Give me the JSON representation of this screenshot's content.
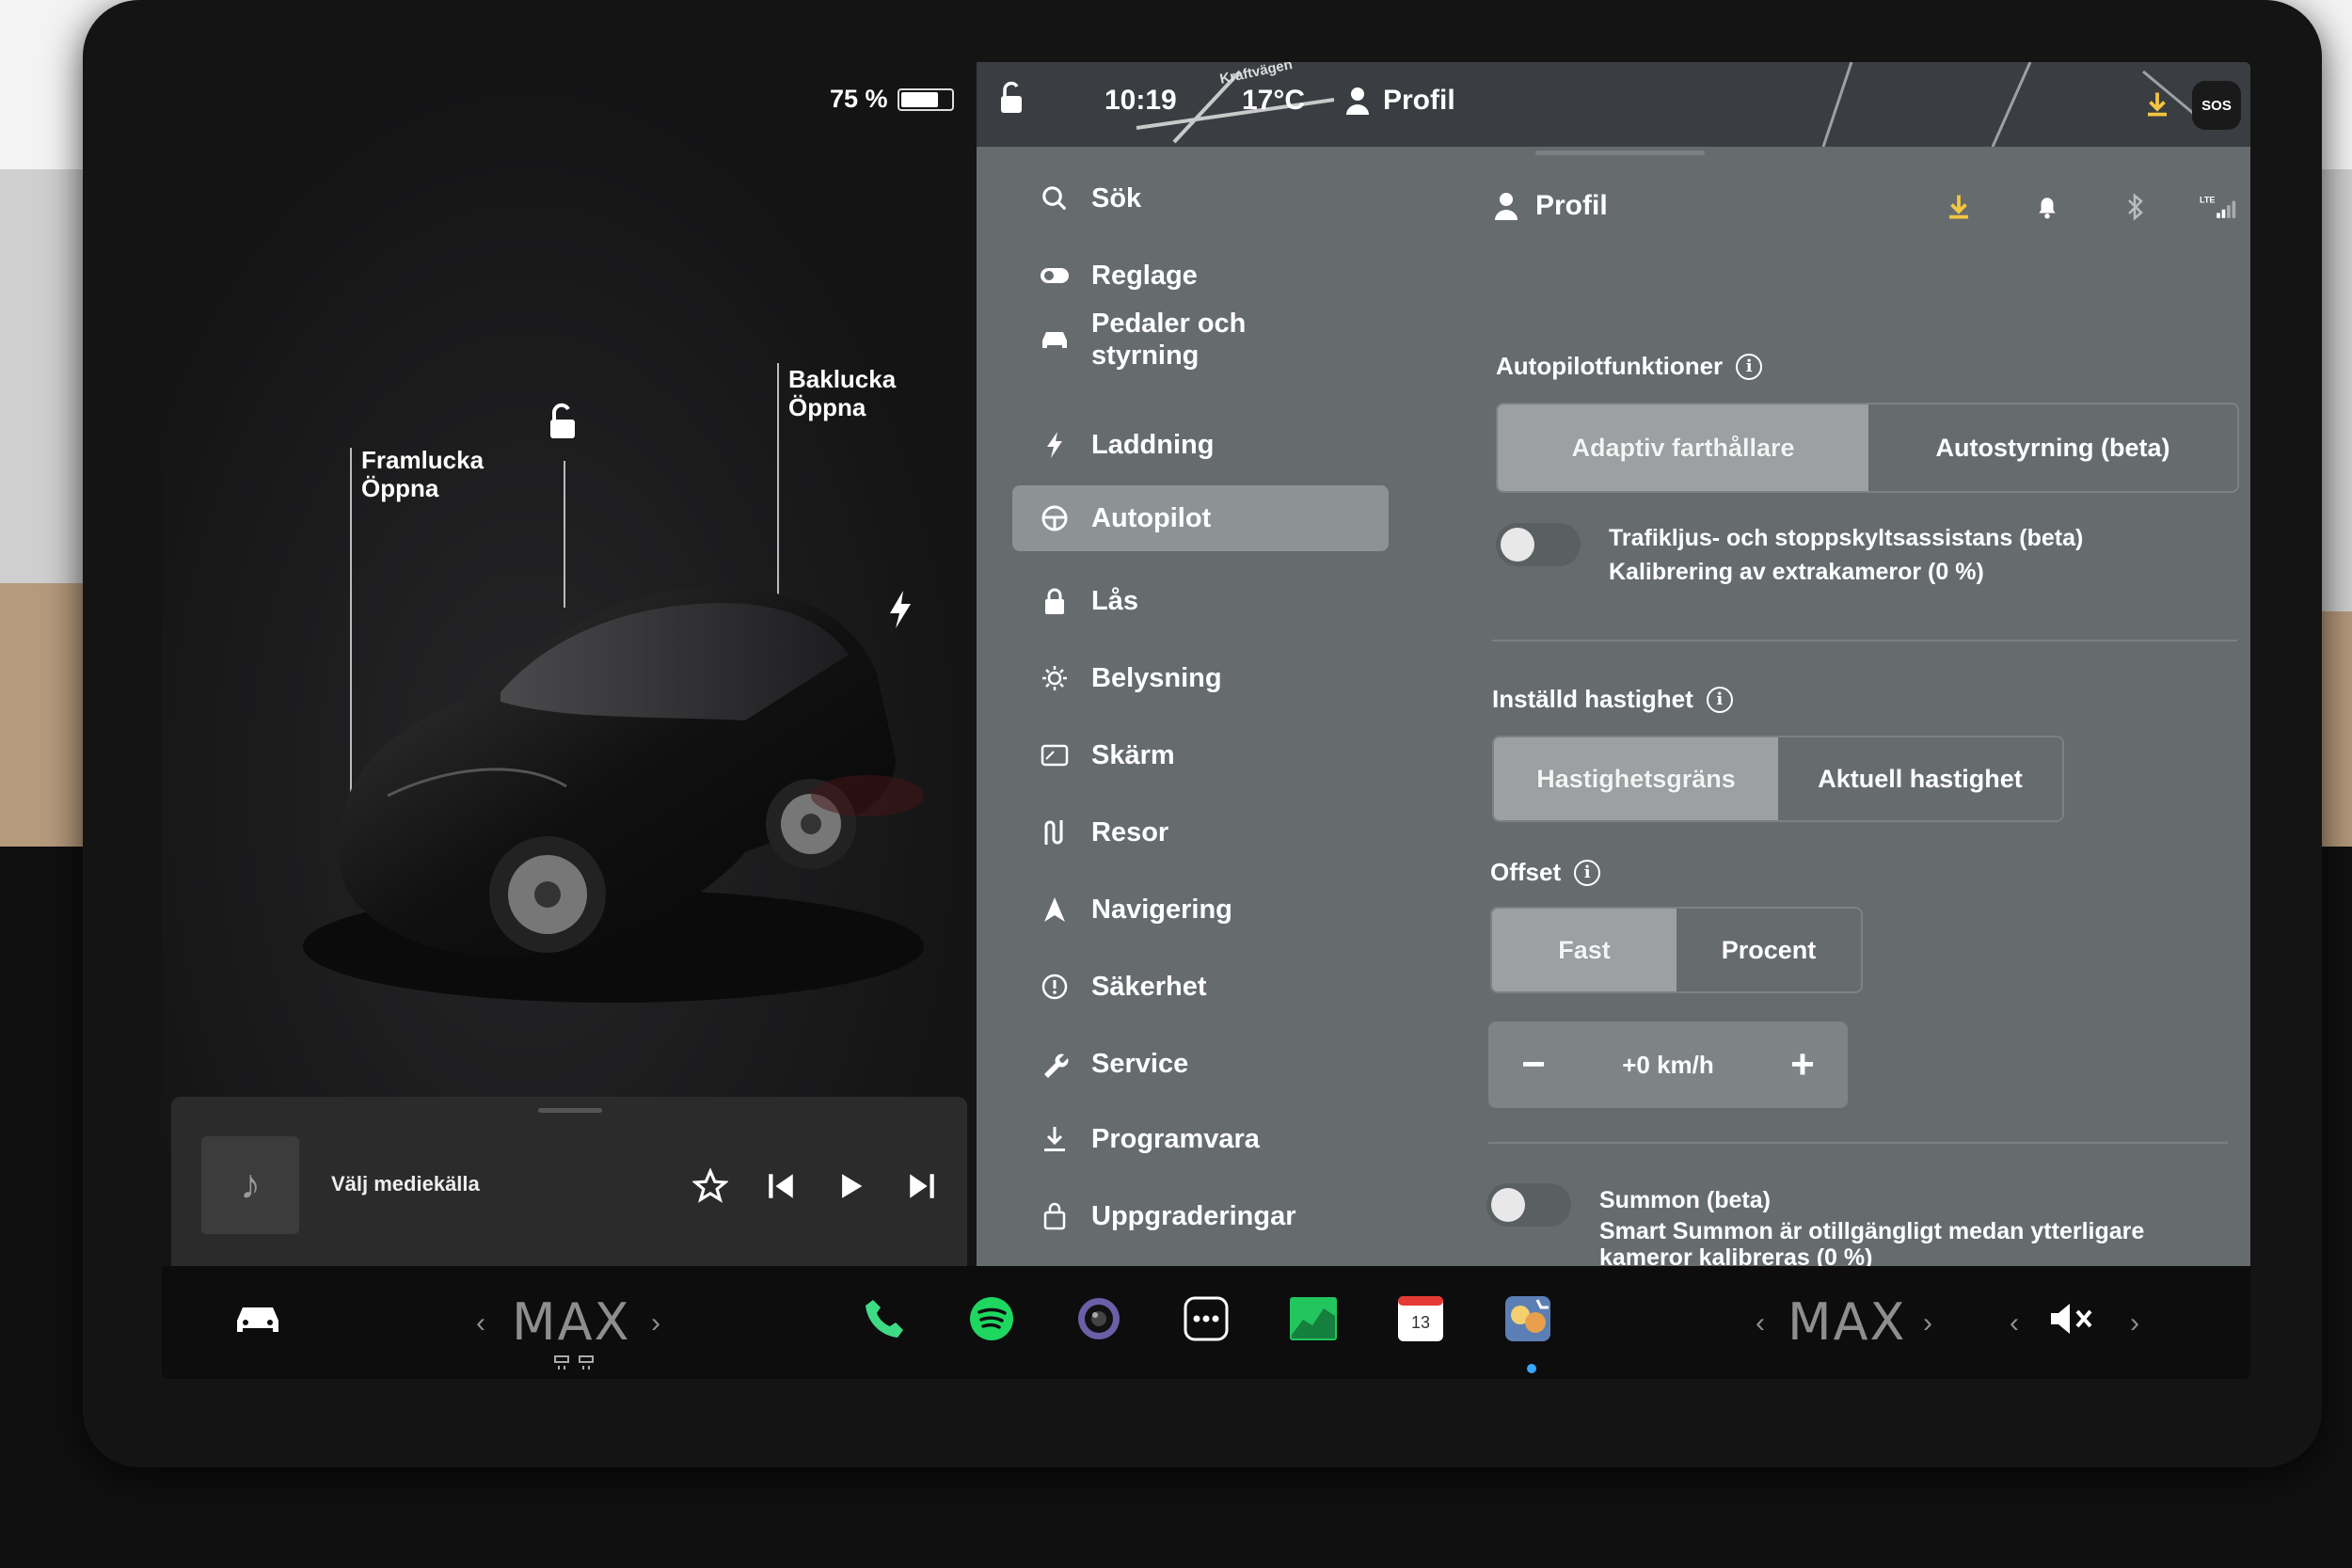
{
  "status": {
    "battery_percent": "75 %",
    "battery_level": 0.75,
    "time": "10:19",
    "temperature": "17°C",
    "profile": "Profil",
    "map_road_label": "Kraftvägen",
    "sos": "SOS"
  },
  "car": {
    "front_label": "Framlucka",
    "front_action": "Öppna",
    "rear_label": "Baklucka",
    "rear_action": "Öppna"
  },
  "media": {
    "source_label": "Välj mediekälla"
  },
  "nav": {
    "items": [
      {
        "label": "Sök",
        "icon": "search-icon"
      },
      {
        "label": "Reglage",
        "icon": "toggle-icon"
      },
      {
        "label": "Pedaler och styrning",
        "icon": "car-icon"
      },
      {
        "label": "Laddning",
        "icon": "bolt-icon"
      },
      {
        "label": "Autopilot",
        "icon": "steering-wheel-icon"
      },
      {
        "label": "Lås",
        "icon": "lock-icon"
      },
      {
        "label": "Belysning",
        "icon": "sun-icon"
      },
      {
        "label": "Skärm",
        "icon": "display-icon"
      },
      {
        "label": "Resor",
        "icon": "trips-icon"
      },
      {
        "label": "Navigering",
        "icon": "navigation-icon"
      },
      {
        "label": "Säkerhet",
        "icon": "safety-icon"
      },
      {
        "label": "Service",
        "icon": "wrench-icon"
      },
      {
        "label": "Programvara",
        "icon": "download-icon"
      },
      {
        "label": "Uppgraderingar",
        "icon": "bag-icon"
      }
    ],
    "active": "Autopilot"
  },
  "content": {
    "header": "Profil",
    "autopilot": {
      "title": "Autopilotfunktioner",
      "options": [
        "Adaptiv farthållare",
        "Autostyrning (beta)"
      ],
      "selected": "Adaptiv farthållare"
    },
    "traffic_light": {
      "title": "Trafikljus- och stoppskyltsassistans (beta)",
      "subtitle": "Kalibrering av extrakameror (0 %)"
    },
    "set_speed": {
      "title": "Inställd hastighet",
      "options": [
        "Hastighetsgräns",
        "Aktuell hastighet"
      ],
      "selected": "Hastighetsgräns"
    },
    "offset": {
      "title": "Offset",
      "options": [
        "Fast",
        "Procent"
      ],
      "selected": "Fast",
      "value": "+0 km/h",
      "minus": "−",
      "plus": "+"
    },
    "summon": {
      "title": "Summon (beta)",
      "subtitle_1": "Smart Summon är otillgängligt medan ytterligare",
      "subtitle_2": "kameror kalibreras (0 %)"
    }
  },
  "taskbar": {
    "left_temp": "MAX",
    "right_temp": "MAX",
    "calendar_day": "13",
    "colors": {
      "phone": "#3ddc84",
      "spotify": "#1ed760",
      "chart": "#22c55e"
    }
  }
}
